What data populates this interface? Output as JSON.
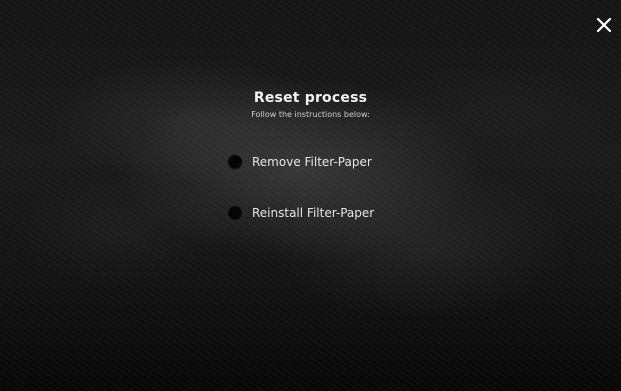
{
  "dialog": {
    "title": "Reset process",
    "subtitle": "Follow the instructions below:",
    "close_icon": "close-icon"
  },
  "steps": [
    {
      "label": "Remove Filter-Paper",
      "checked": false
    },
    {
      "label": "Reinstall Filter-Paper",
      "checked": false
    }
  ],
  "colors": {
    "background": "#141414",
    "text": "#f2f2f2",
    "subtext": "#cfcfcf",
    "radio_fill": "#050505"
  }
}
